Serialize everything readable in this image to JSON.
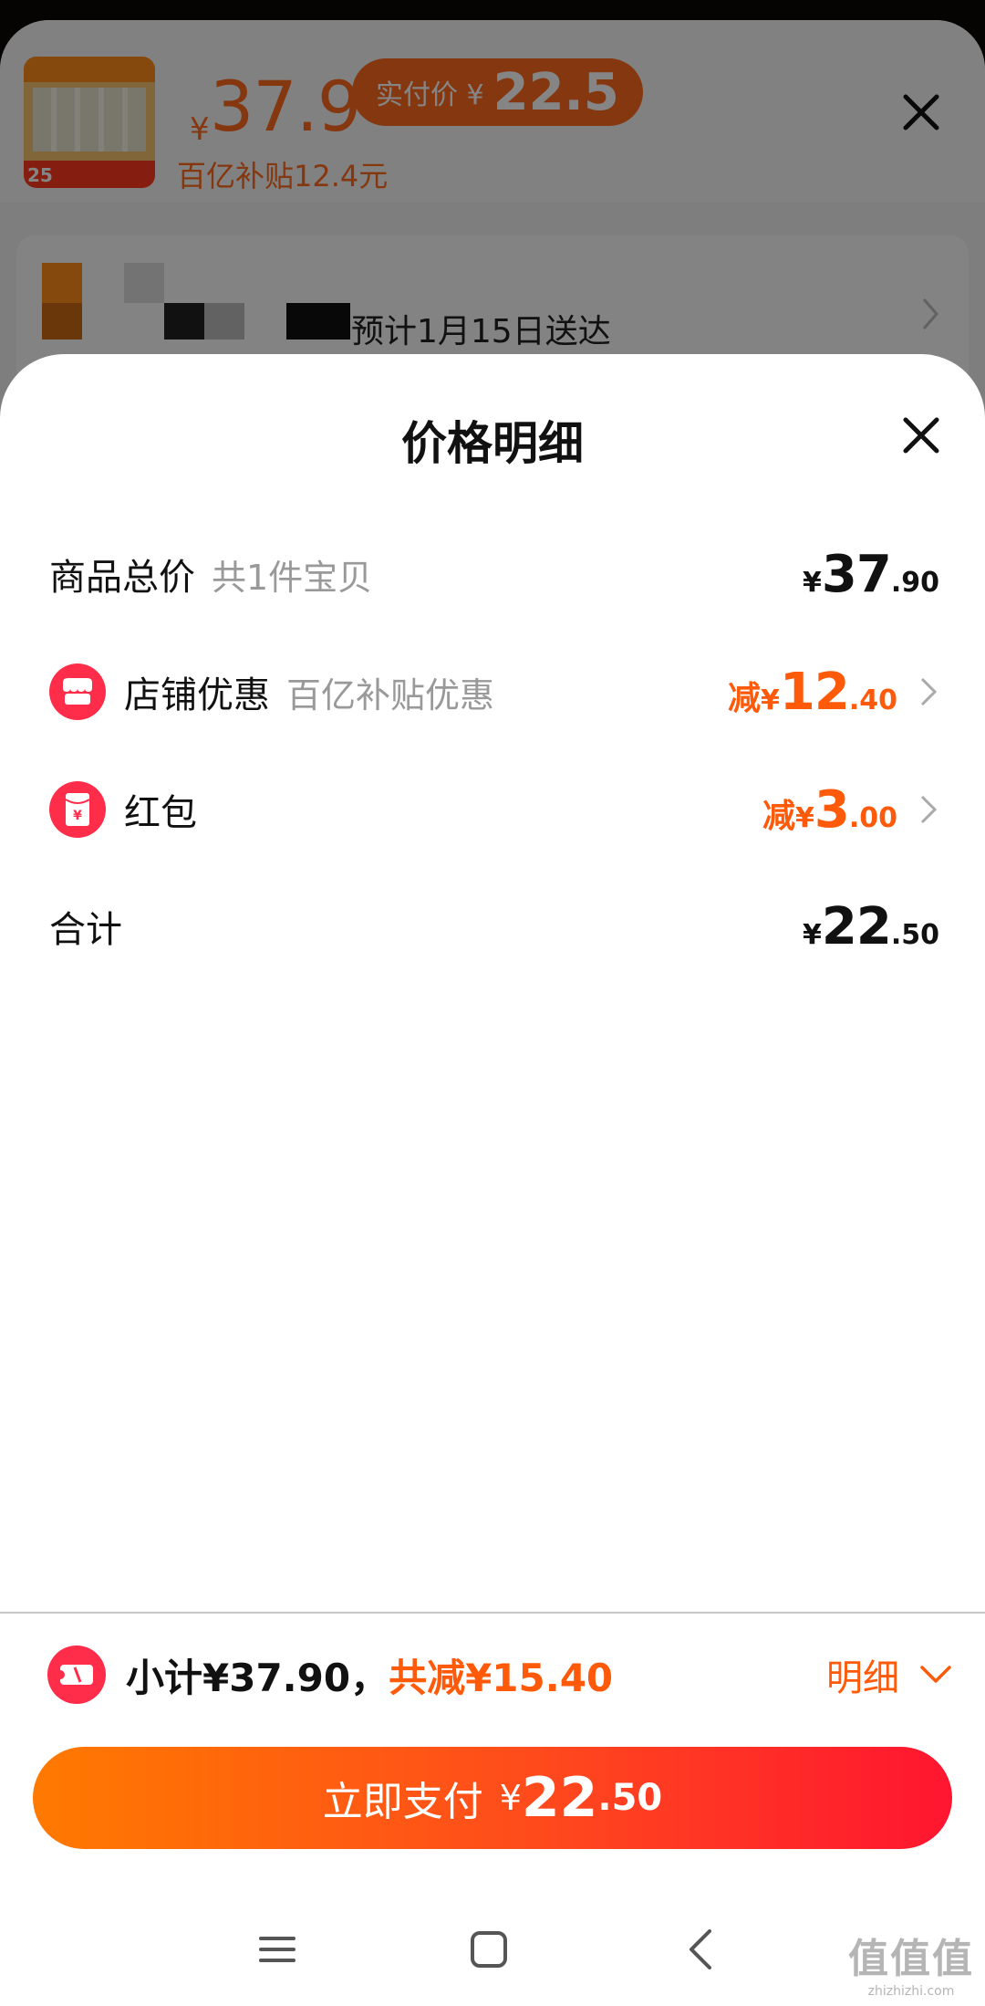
{
  "background": {
    "original_price": "37.9",
    "yen": "¥",
    "pill_label": "实付价 ¥",
    "pill_value": "22.5",
    "subsidy_text": "百亿补贴12.4元",
    "thumb_badge": "25",
    "delivery_text": "预计1月15日送达"
  },
  "modal": {
    "title": "价格明细",
    "rows": [
      {
        "label": "商品总价",
        "note": "共1件宝贝",
        "prefix": "",
        "yen": "¥",
        "int": "37",
        "dec": ".90"
      },
      {
        "label": "店铺优惠",
        "note": "百亿补贴优惠",
        "prefix": "减",
        "yen": "¥",
        "int": "12",
        "dec": ".40",
        "icon": "shop-icon"
      },
      {
        "label": "红包",
        "note": "",
        "prefix": "减",
        "yen": "¥",
        "int": "3",
        "dec": ".00",
        "icon": "red-packet-icon"
      },
      {
        "label": "合计",
        "note": "",
        "prefix": "",
        "yen": "¥",
        "int": "22",
        "dec": ".50"
      }
    ]
  },
  "summary": {
    "subtotal": "小计¥37.90，",
    "reduction": "共减¥15.40",
    "detail_label": "明细"
  },
  "pay_button": {
    "label": "立即支付",
    "yen": "¥",
    "int": "22",
    "dec": ".50"
  },
  "watermark": {
    "chars": "值值值",
    "url": "zhizhizhi.com"
  },
  "colors": {
    "accent": "#ff5a0a",
    "button_start": "#ff7a00",
    "button_end": "#ff1530"
  }
}
